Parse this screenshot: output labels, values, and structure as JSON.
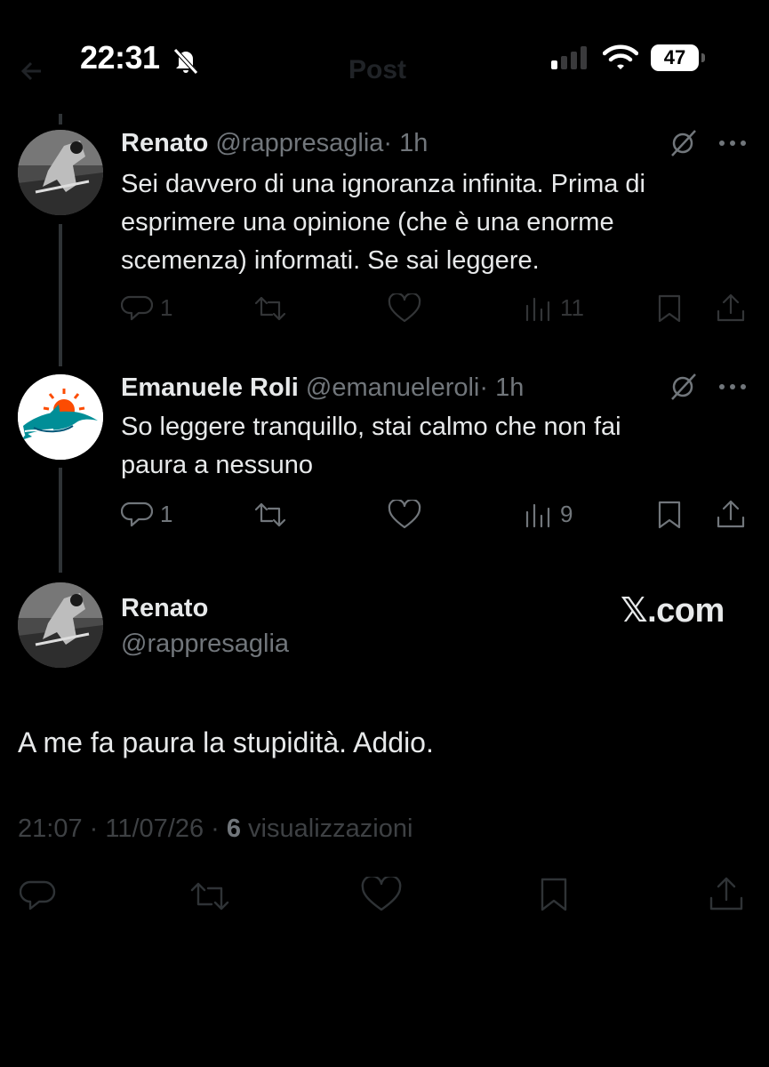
{
  "status_bar": {
    "time": "22:31",
    "battery": "47",
    "ghost_title": "Post"
  },
  "tweets": [
    {
      "name": "Renato",
      "handle": "@rappresaglia",
      "time": "· 1h",
      "lines": [
        "Sei davvero di una ignoranza infinita. Prima di",
        "esprimere una opinione (che è una enorme",
        "scemenza) informati. Se sai leggere."
      ],
      "replies": "1",
      "views": "11"
    },
    {
      "name": "Emanuele Roli",
      "handle": "@emanueleroli",
      "time": "· 1h",
      "lines": [
        "So leggere tranquillo, stai calmo che non fai",
        "paura a nessuno"
      ],
      "replies": "1",
      "views": "9"
    }
  ],
  "main_post": {
    "name": "Renato",
    "handle": "@rappresaglia",
    "watermark": "𝕏.com",
    "text": "A me fa paura la stupidità. Addio.",
    "time": "21:07 · 11/07/26 · ",
    "views_count": "6",
    "views_label": " visualizzazioni"
  },
  "colors": {
    "background": "#000000",
    "text": "#e7e9ea",
    "muted": "#71767b",
    "dim_icons": "#2f3336",
    "dolphin_aqua": "#008e97",
    "dolphin_orange": "#fc4c02"
  },
  "icons": [
    "bell-slash-icon",
    "signal-icon",
    "wifi-icon",
    "battery-icon",
    "grok-icon",
    "more-icon",
    "reply-icon",
    "retweet-icon",
    "like-icon",
    "views-icon",
    "bookmark-icon",
    "share-icon"
  ]
}
